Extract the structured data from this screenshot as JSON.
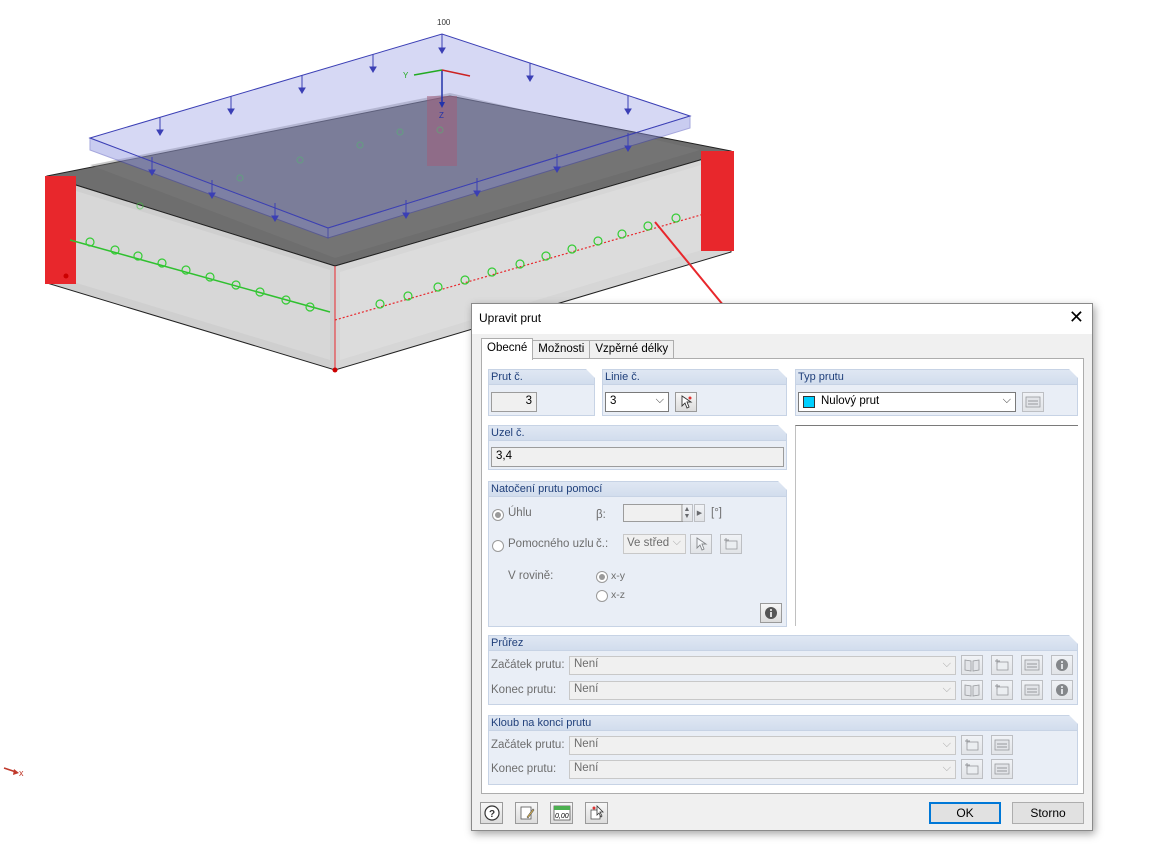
{
  "viewport": {
    "axis_labels": {
      "top_value": "100",
      "y": "Y",
      "z": "Z",
      "x": "x"
    },
    "colors": {
      "support": "#e8272c",
      "load": "#3b3fb5",
      "hinge": "#33cc33",
      "highlight": "#e8272c"
    }
  },
  "dialog": {
    "title": "Upravit prut",
    "close_icon": "close-icon",
    "tabs": [
      "Obecné",
      "Možnosti",
      "Vzpěrné délky"
    ],
    "member_no": {
      "label": "Prut č.",
      "value": "3"
    },
    "line_no": {
      "label": "Linie č.",
      "value": "3"
    },
    "member_type": {
      "label": "Typ prutu",
      "value": "Nulový prut",
      "color": "#00d0ff"
    },
    "node_no": {
      "label": "Uzel č.",
      "value": "3,4"
    },
    "rotation": {
      "label": "Natočení prutu pomocí",
      "angle_option": "Úhlu",
      "beta_label": "β:",
      "beta_value": "",
      "unit": "[°]",
      "helper_node_option": "Pomocného uzlu",
      "no_label": "č.:",
      "helper_node_value": "Ve střed",
      "plane_label": "V rovině:",
      "plane_xy": "x-y",
      "plane_xz": "x-z"
    },
    "section": {
      "label": "Průřez",
      "start_label": "Začátek prutu:",
      "start_value": "Není",
      "end_label": "Konec prutu:",
      "end_value": "Není"
    },
    "hinge": {
      "label": "Kloub na konci prutu",
      "start_label": "Začátek prutu:",
      "start_value": "Není",
      "end_label": "Konec prutu:",
      "end_value": "Není"
    },
    "buttons": {
      "ok": "OK",
      "cancel": "Storno",
      "units_icon_text": "0,00"
    }
  }
}
